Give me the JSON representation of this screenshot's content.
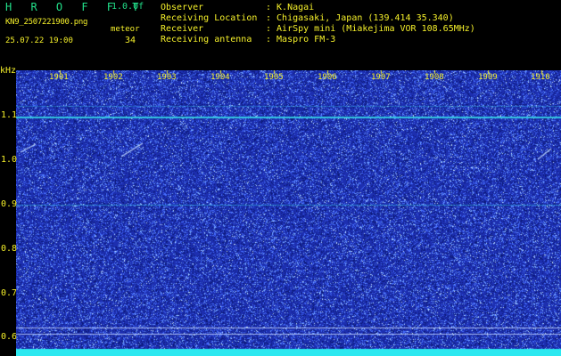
{
  "header": {
    "app_title": "H R O F F T",
    "version": "1.0.0f",
    "filename": "KN9_2507221900.png",
    "mode_label": "meteor",
    "datetime": "25.07.22 19:00",
    "count": "34"
  },
  "meta": [
    {
      "key": "Observer",
      "value": ": K.Nagai"
    },
    {
      "key": "Receiving Location",
      "value": ": Chigasaki, Japan (139.414 35.340)"
    },
    {
      "key": "Receiver",
      "value": ": AirSpy mini (Miakejima VOR 108.65MHz)"
    },
    {
      "key": "Receiving antenna",
      "value": ": Maspro FM-3"
    }
  ],
  "axis": {
    "unit_label": "kHz",
    "minutes": [
      "1901",
      "1902",
      "1903",
      "1904",
      "1905",
      "1906",
      "1907",
      "1908",
      "1909",
      "1910"
    ],
    "yticks": [
      "1.1",
      "1.0",
      "0.9",
      "0.8",
      "0.7",
      "0.6"
    ]
  },
  "colors": {
    "background": "#000000",
    "plot_base": "#1d2fb0",
    "noise": "#4a7bff",
    "trace": "#35d4e6",
    "floor": "#2ce8f0",
    "meta_text": "#f5f02a",
    "title_text": "#22e08a"
  }
}
